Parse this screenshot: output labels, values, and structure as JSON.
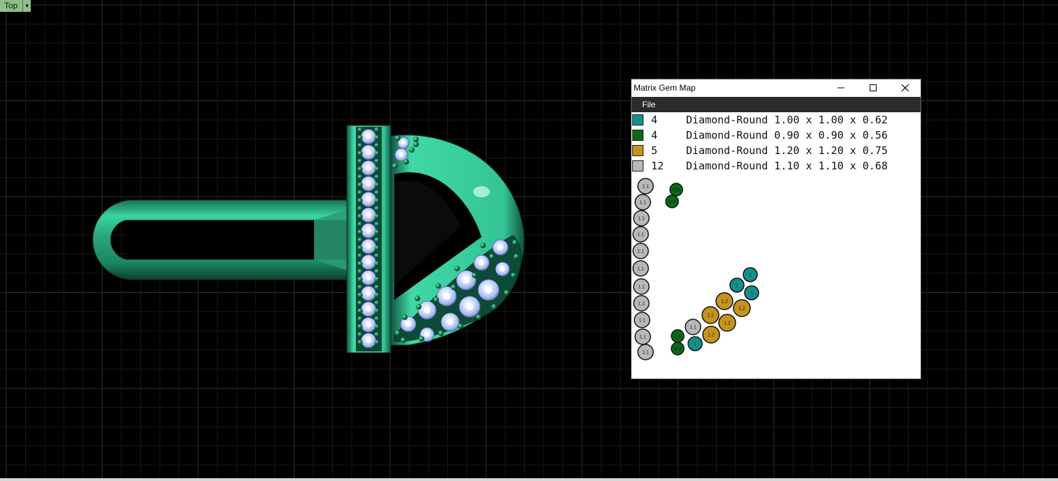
{
  "viewport": {
    "name": "Top"
  },
  "gem_window": {
    "title": "Matrix Gem Map",
    "menu": [
      "File"
    ],
    "legend": [
      {
        "count": "4",
        "description": "Diamond-Round 1.00 x 1.00 x 0.62",
        "color": "#12918c"
      },
      {
        "count": "4",
        "description": "Diamond-Round 0.90 x 0.90 x 0.56",
        "color": "#0a6a14"
      },
      {
        "count": "5",
        "description": "Diamond-Round 1.20 x 1.20 x 0.75",
        "color": "#c6931c"
      },
      {
        "count": "12",
        "description": "Diamond-Round 1.10 x 1.10 x 0.68",
        "color": "#b8b8b8"
      }
    ],
    "gem_labels": {
      "teal": "1",
      "green": "0.9",
      "gold": "1.2",
      "gray": "1.1"
    }
  }
}
